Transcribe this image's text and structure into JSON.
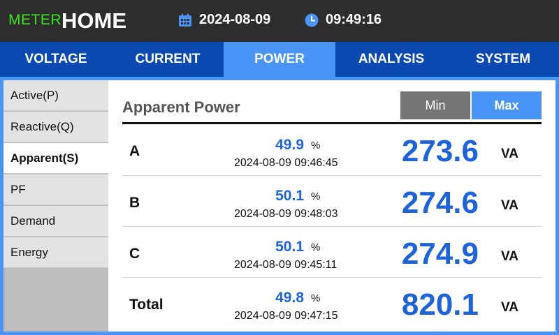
{
  "header": {
    "brand_prefix": "METER",
    "brand_title": "HOME",
    "date": "2024-08-09",
    "time": "09:49:16"
  },
  "tabs": [
    {
      "label": "VOLTAGE",
      "active": false
    },
    {
      "label": "CURRENT",
      "active": false
    },
    {
      "label": "POWER",
      "active": true
    },
    {
      "label": "ANALYSIS",
      "active": false
    },
    {
      "label": "SYSTEM",
      "active": false
    }
  ],
  "sidebar": {
    "items": [
      {
        "label": "Active(P)",
        "active": false
      },
      {
        "label": "Reactive(Q)",
        "active": false
      },
      {
        "label": "Apparent(S)",
        "active": true
      },
      {
        "label": "PF",
        "active": false
      },
      {
        "label": "Demand",
        "active": false
      },
      {
        "label": "Energy",
        "active": false
      }
    ]
  },
  "panel": {
    "title": "Apparent Power",
    "min_label": "Min",
    "max_label": "Max",
    "selected": "Max",
    "rows": [
      {
        "phase": "A",
        "percent": "49.9",
        "percent_unit": "%",
        "timestamp": "2024-08-09 09:46:45",
        "value": "273.6",
        "unit": "VA"
      },
      {
        "phase": "B",
        "percent": "50.1",
        "percent_unit": "%",
        "timestamp": "2024-08-09 09:48:03",
        "value": "274.6",
        "unit": "VA"
      },
      {
        "phase": "C",
        "percent": "50.1",
        "percent_unit": "%",
        "timestamp": "2024-08-09 09:45:11",
        "value": "274.9",
        "unit": "VA"
      },
      {
        "phase": "Total",
        "percent": "49.8",
        "percent_unit": "%",
        "timestamp": "2024-08-09 09:47:15",
        "value": "820.1",
        "unit": "VA"
      }
    ]
  },
  "colors": {
    "header_bg": "#2d2d2d",
    "brand_accent": "#3ee51f",
    "tab_bar": "#0a4ab0",
    "accent_blue": "#4a94f5",
    "value_blue": "#1e63d8",
    "min_button": "#757575"
  },
  "icons": {
    "date": "calendar-icon",
    "time": "clock-icon"
  }
}
